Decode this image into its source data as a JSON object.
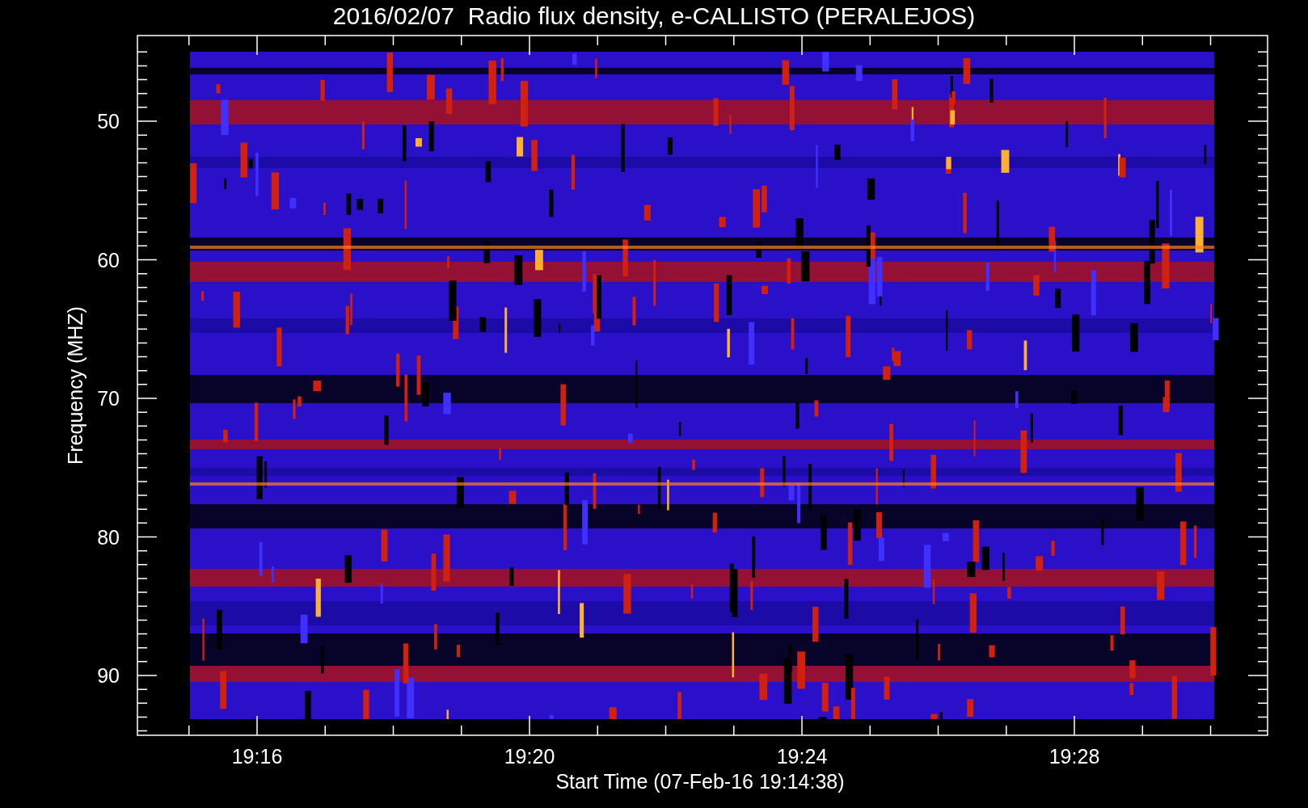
{
  "title": "2016/02/07  Radio flux density, e-CALLISTO (PERALEJOS)",
  "y_axis": {
    "label": "Frequency (MHZ)",
    "ticks": [
      "50",
      "60",
      "70",
      "80",
      "90"
    ]
  },
  "x_axis": {
    "label": "Start Time (07-Feb-16 19:14:38)",
    "ticks": [
      "19:16",
      "19:20",
      "19:24",
      "19:28"
    ]
  }
}
